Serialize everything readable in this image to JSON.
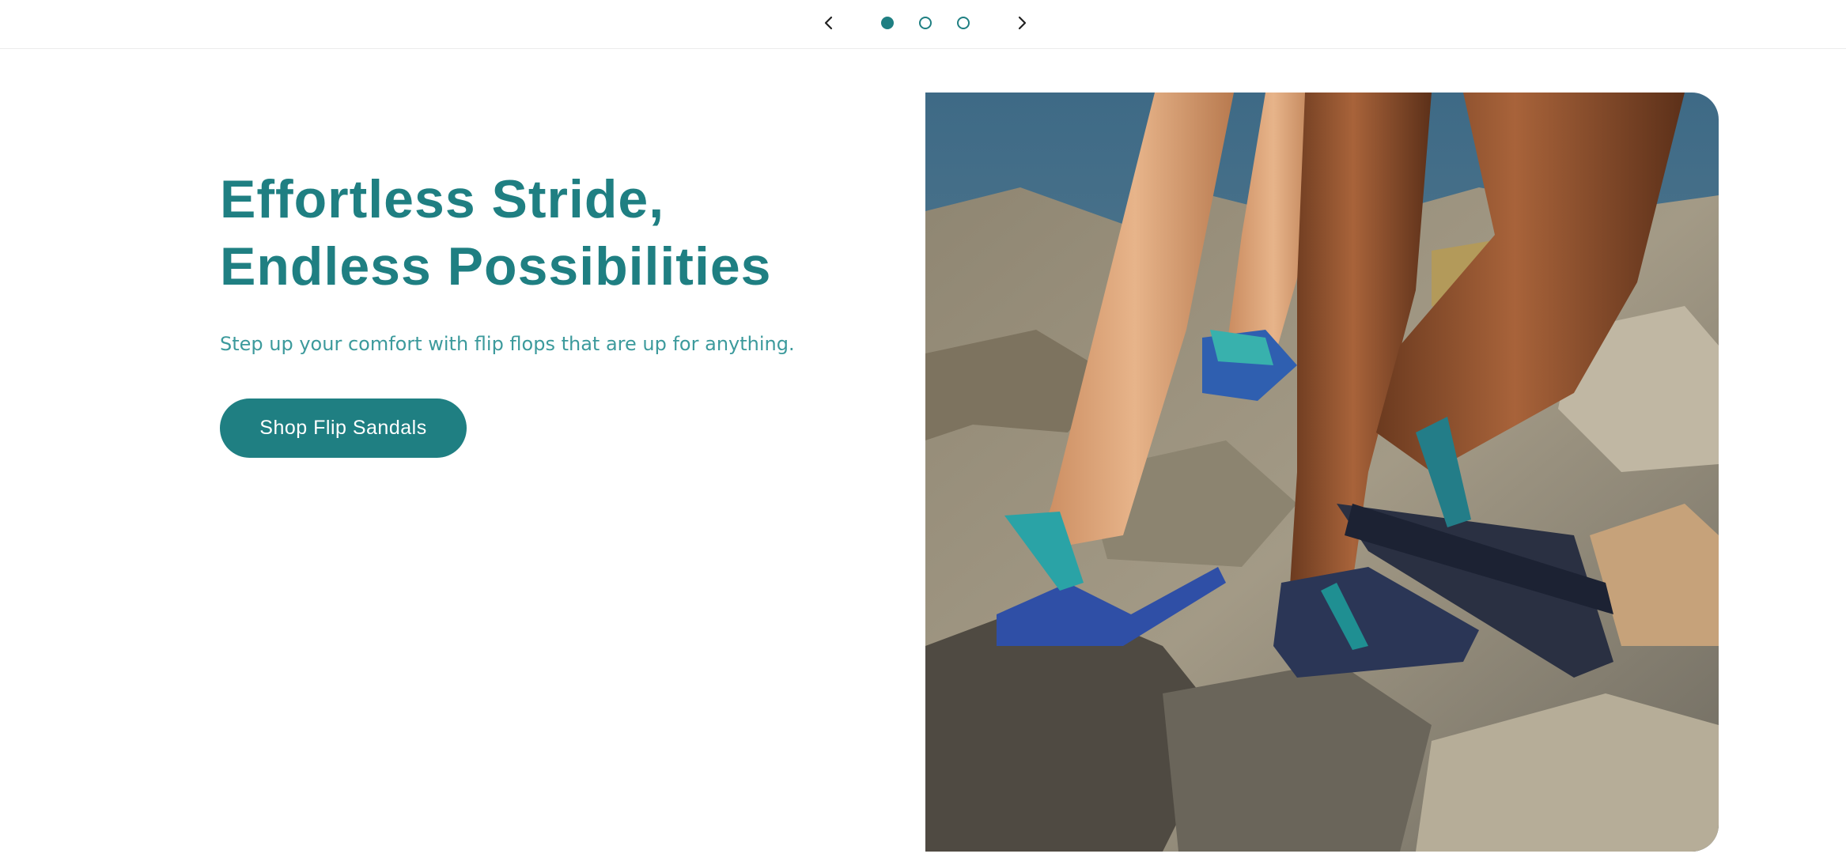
{
  "carousel": {
    "prev_icon": "chevron-left-icon",
    "next_icon": "chevron-right-icon",
    "dots": [
      {
        "label": "slide-1",
        "active": true
      },
      {
        "label": "slide-2",
        "active": false
      },
      {
        "label": "slide-3",
        "active": false
      }
    ]
  },
  "hero": {
    "headline_line1": "Effortless Stride,",
    "headline_line2": "Endless Possibilities",
    "subtext": "Step up your comfort with flip flops that are up for anything.",
    "cta_label": "Shop Flip Sandals"
  },
  "colors": {
    "accent": "#1f7f82",
    "subtext": "#3c9a9c",
    "background": "#ffffff"
  }
}
